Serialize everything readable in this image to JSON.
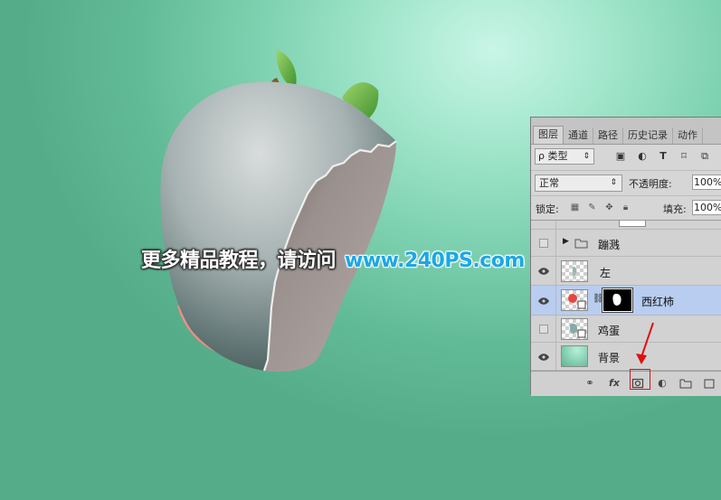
{
  "watermark": {
    "chinese": "更多精品教程，请访问",
    "url": "www.240PS.com"
  },
  "panel": {
    "tabs": [
      {
        "label": "图层",
        "active": true
      },
      {
        "label": "通道",
        "active": false
      },
      {
        "label": "路径",
        "active": false
      },
      {
        "label": "历史记录",
        "active": false
      },
      {
        "label": "动作",
        "active": false
      }
    ],
    "filter": {
      "search_glyph": "ρ",
      "kind_label": "类型"
    },
    "blend_mode": "正常",
    "opacity_label": "不透明度:",
    "opacity_value": "100%",
    "lock_label": "锁定:",
    "fill_label": "填充:",
    "fill_value": "100%",
    "layers": [
      {
        "name": "蹦溅",
        "type": "group",
        "visible": false,
        "selected": false
      },
      {
        "name": "左",
        "type": "smart-object",
        "visible": true,
        "selected": false
      },
      {
        "name": "西红柿",
        "type": "smart-object-with-mask",
        "visible": true,
        "selected": true
      },
      {
        "name": "鸡蛋",
        "type": "smart-object",
        "visible": false,
        "selected": false
      },
      {
        "name": "背景",
        "type": "pixel",
        "visible": true,
        "selected": false
      }
    ],
    "bottom_fx_label": "fx",
    "icons": [
      "link-icon",
      "fx-icon",
      "add-mask-icon",
      "adjustment-icon",
      "folder-icon",
      "new-layer-icon"
    ]
  },
  "colors": {
    "highlight_box": "#e01010",
    "selected_layer": "#b9cdf0",
    "watermark_url": "#1aa8e8"
  }
}
